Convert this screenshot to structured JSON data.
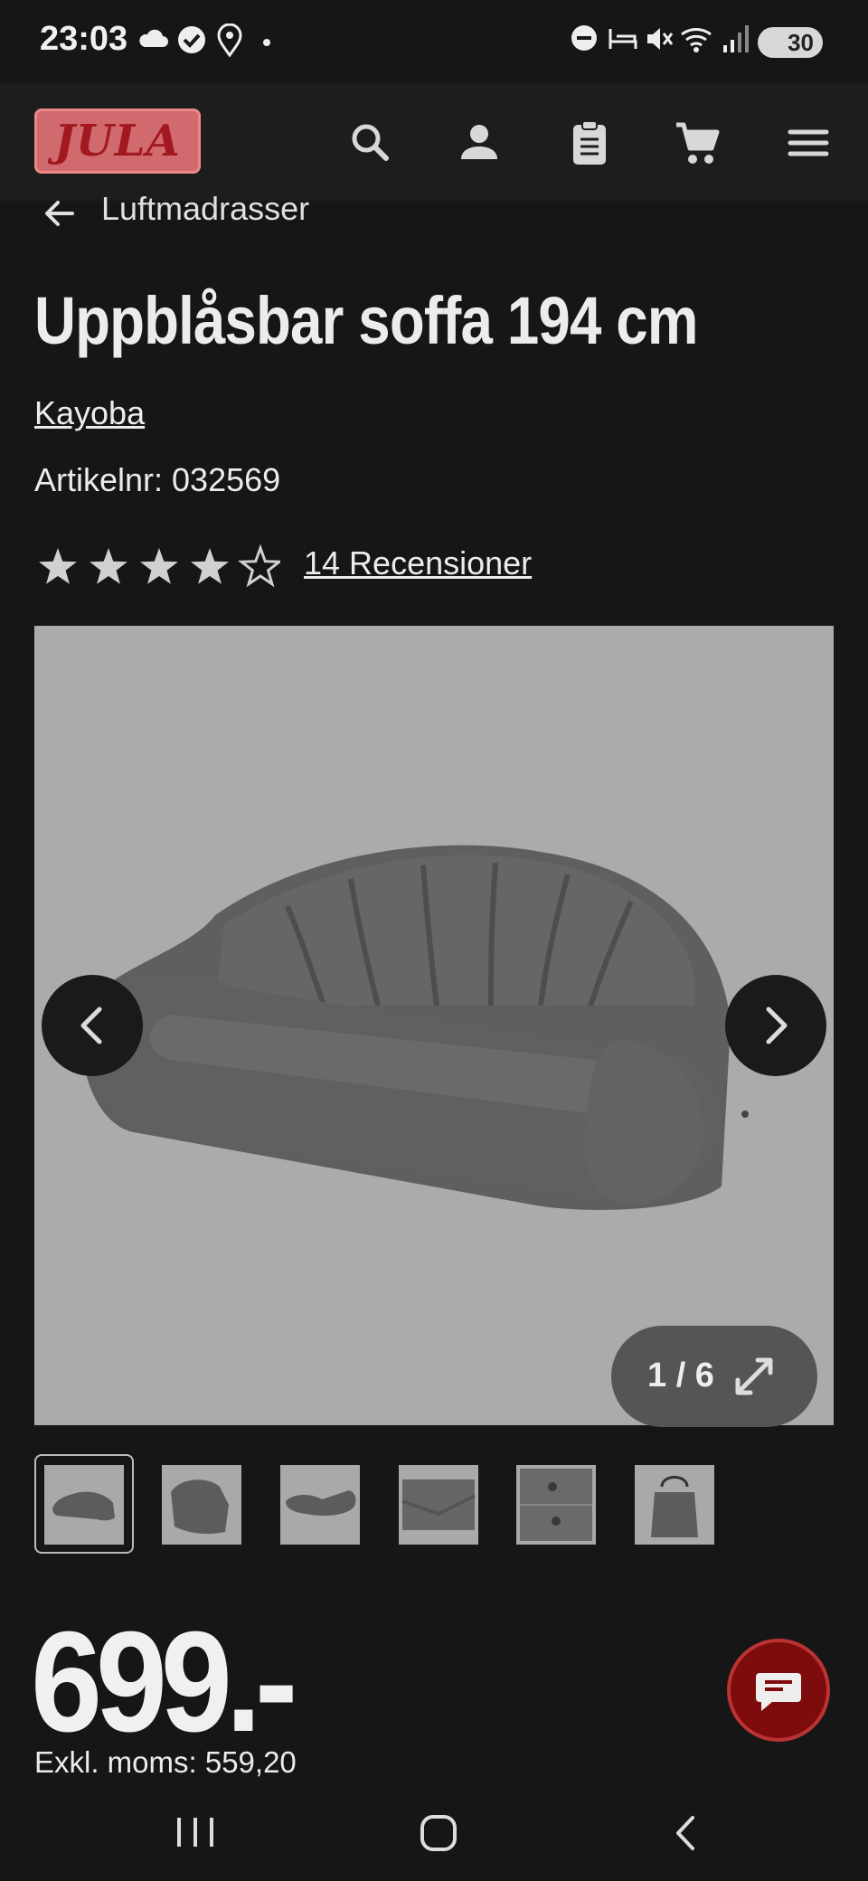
{
  "status_bar": {
    "time": "23:03",
    "battery": "30",
    "icons": [
      "cloud-icon",
      "check-circle-icon",
      "location-icon",
      "dot-icon",
      "dnd-icon",
      "sleep-icon",
      "mute-icon",
      "wifi-icon",
      "signal-icon"
    ]
  },
  "header": {
    "logo": "JULA",
    "icons": [
      "search-icon",
      "account-icon",
      "clipboard-icon",
      "cart-icon",
      "menu-icon"
    ]
  },
  "breadcrumb": {
    "label": "Luftmadrasser"
  },
  "product": {
    "title": "Uppblåsbar soffa 194 cm",
    "brand": "Kayoba",
    "article": "Artikelnr: 032569",
    "rating": 4,
    "rating_max": 5,
    "reviews": "14 Recensioner",
    "price": "699.-",
    "price_excl": "Exkl. moms: 559,20"
  },
  "gallery": {
    "counter": "1 / 6",
    "current": 1,
    "total": 6
  },
  "colors": {
    "background": "#161616",
    "header": "#1d1d1d",
    "chat": "#7e0c0c",
    "logo": "#d06a6f"
  }
}
